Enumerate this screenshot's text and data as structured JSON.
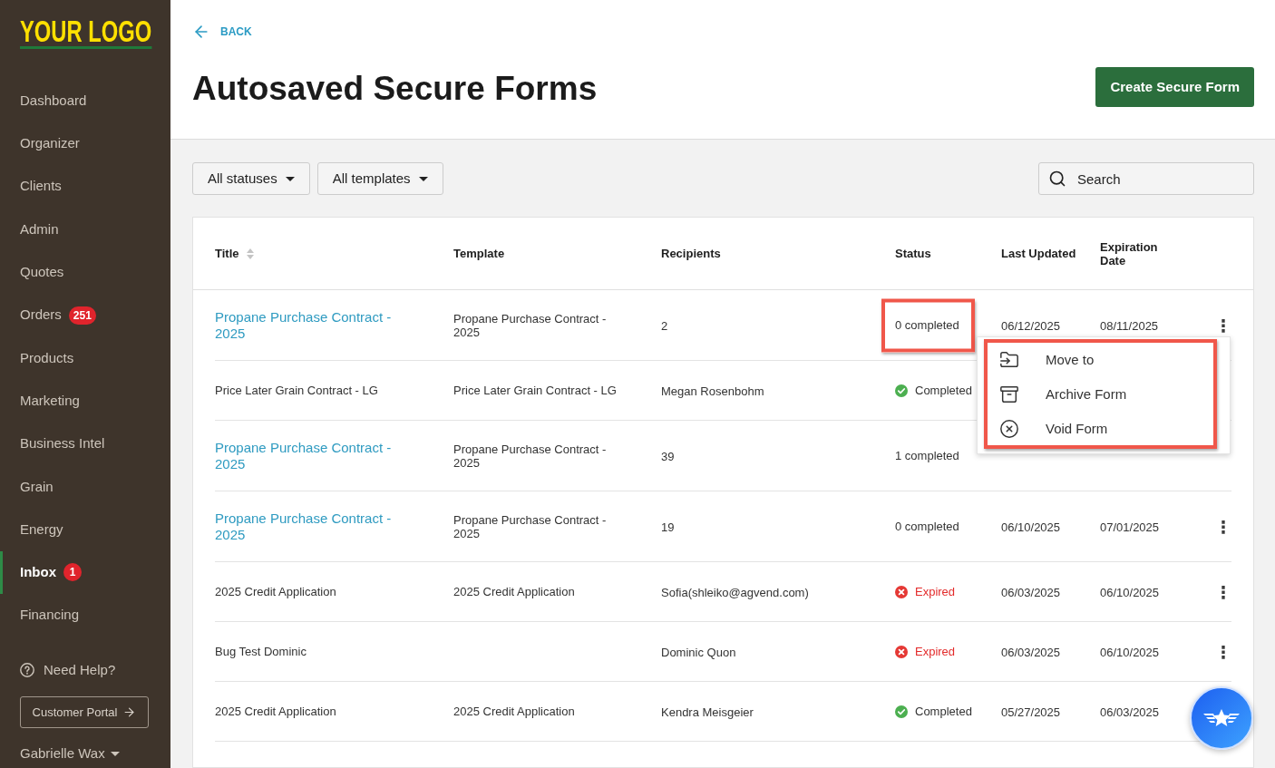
{
  "sidebar": {
    "logo": "YOUR LOGO",
    "items": [
      {
        "label": "Dashboard",
        "selected": false
      },
      {
        "label": "Organizer",
        "selected": false
      },
      {
        "label": "Clients",
        "selected": false
      },
      {
        "label": "Admin",
        "selected": false
      },
      {
        "label": "Quotes",
        "selected": false
      },
      {
        "label": "Orders",
        "selected": false,
        "badge": "251"
      },
      {
        "label": "Products",
        "selected": false
      },
      {
        "label": "Marketing",
        "selected": false
      },
      {
        "label": "Business Intel",
        "selected": false
      },
      {
        "label": "Grain",
        "selected": false
      },
      {
        "label": "Energy",
        "selected": false
      },
      {
        "label": "Inbox",
        "selected": true,
        "badge": "1"
      },
      {
        "label": "Financing",
        "selected": false
      }
    ],
    "help": "Need Help?",
    "portal_button": "Customer Portal",
    "user": "Gabrielle Wax"
  },
  "header": {
    "back": "BACK",
    "title": "Autosaved Secure Forms",
    "create_button": "Create Secure Form"
  },
  "filters": {
    "dropdowns": [
      "All statuses",
      "All templates"
    ],
    "search": {
      "placeholder": "Search"
    }
  },
  "table": {
    "columns": [
      {
        "label": "Title",
        "sortable": true
      },
      {
        "label": "Template",
        "sortable": false
      },
      {
        "label": "Recipients",
        "sortable": false
      },
      {
        "label": "Status",
        "sortable": false
      },
      {
        "label": "Last Updated",
        "sortable": false
      },
      {
        "label": "Expiration Date",
        "sortable": false
      }
    ],
    "rows": [
      {
        "title": "Propane Purchase Contract - 2025",
        "title_link": true,
        "template": "Propane Purchase Contract - 2025",
        "recipients": "2",
        "status": {
          "kind": "count",
          "text": "0 completed"
        },
        "last_updated": "06/12/2025",
        "expiration": "08/11/2025",
        "status_highlighted": true,
        "actions": "⋮"
      },
      {
        "title": "Price Later Grain Contract - LG",
        "title_link": false,
        "template": "Price Later Grain Contract - LG",
        "recipients": "Megan Rosenbohm",
        "status": {
          "kind": "completed",
          "text": "Completed"
        },
        "status_highlighted": false
      },
      {
        "title": "Propane Purchase Contract - 2025",
        "title_link": true,
        "template": "Propane Purchase Contract - 2025",
        "recipients": "39",
        "status": {
          "kind": "count",
          "text": "1 completed"
        },
        "status_highlighted": false
      },
      {
        "title": "Propane Purchase Contract - 2025",
        "title_link": true,
        "template": "Propane Purchase Contract - 2025",
        "recipients": "19",
        "status": {
          "kind": "count",
          "text": "0 completed"
        },
        "last_updated": "06/10/2025",
        "expiration": "07/01/2025",
        "status_highlighted": false,
        "actions": "⋮"
      },
      {
        "title": "2025 Credit Application",
        "title_link": false,
        "template": "2025 Credit Application",
        "recipients": "Sofia(shleiko@agvend.com)",
        "status": {
          "kind": "expired",
          "text": "Expired"
        },
        "last_updated": "06/03/2025",
        "expiration": "06/10/2025",
        "status_highlighted": false,
        "actions": "⋮"
      },
      {
        "title": "Bug Test Dominic",
        "title_link": false,
        "recipients": "Dominic Quon",
        "status": {
          "kind": "expired",
          "text": "Expired"
        },
        "last_updated": "06/03/2025",
        "expiration": "06/10/2025",
        "status_highlighted": false,
        "actions": "⋮"
      },
      {
        "title": "2025 Credit Application",
        "title_link": false,
        "template": "2025 Credit Application",
        "recipients": "Kendra Meisgeier",
        "status": {
          "kind": "completed",
          "text": "Completed"
        },
        "last_updated": "05/27/2025",
        "expiration": "06/03/2025",
        "status_highlighted": false
      }
    ]
  },
  "row_menu": {
    "highlighted": true,
    "items": [
      {
        "label": "Move to",
        "kind": "move"
      },
      {
        "label": "Archive Form",
        "kind": "archive"
      },
      {
        "label": "Void Form",
        "kind": "void"
      }
    ]
  }
}
